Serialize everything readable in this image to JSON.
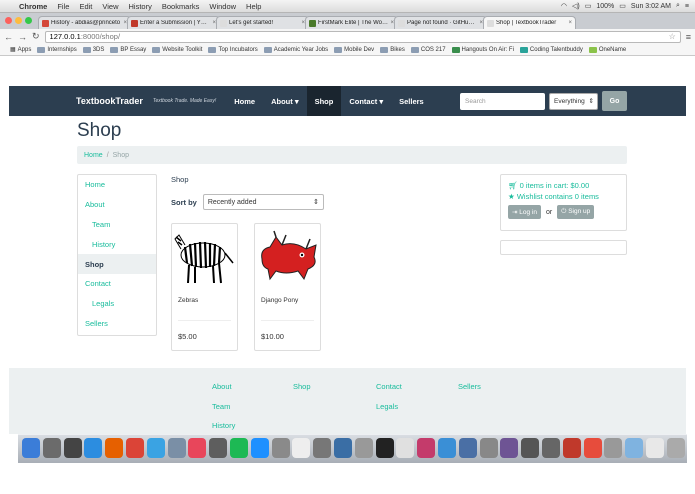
{
  "menubar": {
    "app": "Chrome",
    "items": [
      "File",
      "Edit",
      "View",
      "History",
      "Bookmarks",
      "Window",
      "Help"
    ],
    "battery": "100%",
    "clock": "Sun 3:02 AM"
  },
  "tabs": [
    {
      "title": "History - abdias@princeto",
      "favicon": "#d44638"
    },
    {
      "title": "Enter a Submission | YHac",
      "favicon": "#c0392b"
    },
    {
      "title": "Let's get started!",
      "favicon": "#dddddd"
    },
    {
      "title": "FirstMark Elite | The World",
      "favicon": "#4a7a2a"
    },
    {
      "title": "Page not found · GitHub Pa",
      "favicon": "#dddddd"
    },
    {
      "title": "Shop | TextbookTrader",
      "favicon": "#dddddd"
    }
  ],
  "omnibox": {
    "host": "127.0.0.1",
    "path": ":8000/shop/"
  },
  "bookmarks": [
    "Apps",
    "Internships",
    "3DS",
    "BP Essay",
    "Website Toolkit",
    "Top Incubators",
    "Academic Year Jobs",
    "Mobile Dev",
    "Bikes",
    "COS 217",
    "Hangouts On Air: Fi",
    "Coding Talentbuddy",
    "OneName"
  ],
  "site": {
    "brand": "TextbookTrader",
    "tagline": "Textbook Trade. Made Easy!",
    "nav": [
      "Home",
      "About ▾",
      "Shop",
      "Contact ▾",
      "Sellers"
    ],
    "search_placeholder": "Search",
    "search_scope": "Everything",
    "go_label": "Go"
  },
  "page": {
    "title": "Shop",
    "breadcrumb": {
      "home": "Home",
      "sep": "/",
      "current": "Shop"
    },
    "section_label": "Shop",
    "sort_label": "Sort by",
    "sort_value": "Recently added"
  },
  "sidenav": [
    "Home",
    "About",
    "Team",
    "History",
    "Shop",
    "Contact",
    "Legals",
    "Sellers"
  ],
  "products": [
    {
      "name": "Zebras",
      "price": "$5.00"
    },
    {
      "name": "Django Pony",
      "price": "$10.00"
    }
  ],
  "cart": {
    "items_text": "0 items in cart: $0.00",
    "wishlist_text": "Wishlist contains 0 items",
    "login": "Log in",
    "or": "or",
    "signup": "Sign up"
  },
  "footer": [
    "About",
    "Shop",
    "Contact",
    "Sellers",
    "Team",
    "Legals",
    "History"
  ],
  "colors": {
    "navbar": "#2c3e50",
    "accent": "#18bc9c",
    "muted": "#95a5a6",
    "light": "#ecf0f1"
  }
}
